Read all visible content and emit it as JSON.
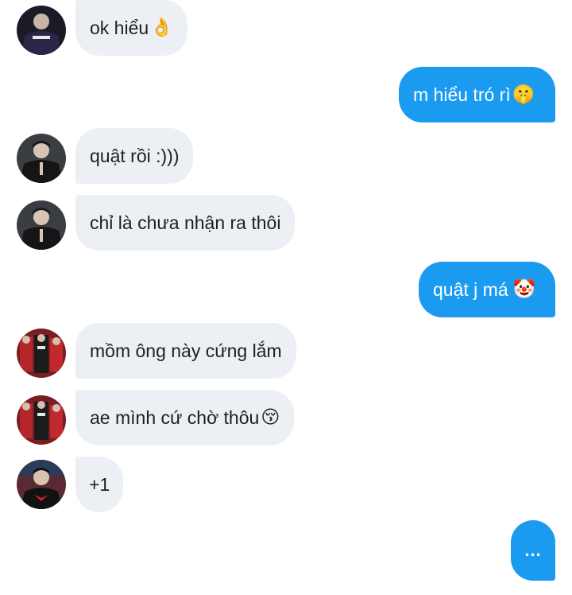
{
  "messages": [
    {
      "direction": "incoming",
      "avatar": "avatar-dark-hoodie",
      "text": "ok hiểu",
      "emoji": "👌"
    },
    {
      "direction": "outgoing",
      "text": "m hiểu tró rì",
      "emoji": "🤫"
    },
    {
      "direction": "incoming",
      "avatar": "avatar-man-black-jacket",
      "text": "quật rồi :)))",
      "emoji": ""
    },
    {
      "direction": "incoming",
      "avatar": "avatar-man-black-jacket",
      "text": "chỉ là chưa nhận ra thôi",
      "emoji": ""
    },
    {
      "direction": "outgoing",
      "text": "quật j má",
      "emoji": "🤡"
    },
    {
      "direction": "incoming",
      "avatar": "avatar-group-red-stage",
      "text": "mồm ông này cứng lắm",
      "emoji": ""
    },
    {
      "direction": "incoming",
      "avatar": "avatar-group-red-stage",
      "text": "ae mình cứ chờ thôu",
      "emoji": "😚"
    },
    {
      "direction": "incoming",
      "avatar": "avatar-esports-player",
      "text": "+1",
      "emoji": ""
    },
    {
      "direction": "outgoing",
      "text": "...",
      "emoji": ""
    }
  ],
  "colors": {
    "incoming_bubble": "#eceff4",
    "outgoing_bubble": "#1b9bf0",
    "incoming_text": "#1f1f1f",
    "outgoing_text": "#ffffff",
    "background": "#ffffff"
  }
}
